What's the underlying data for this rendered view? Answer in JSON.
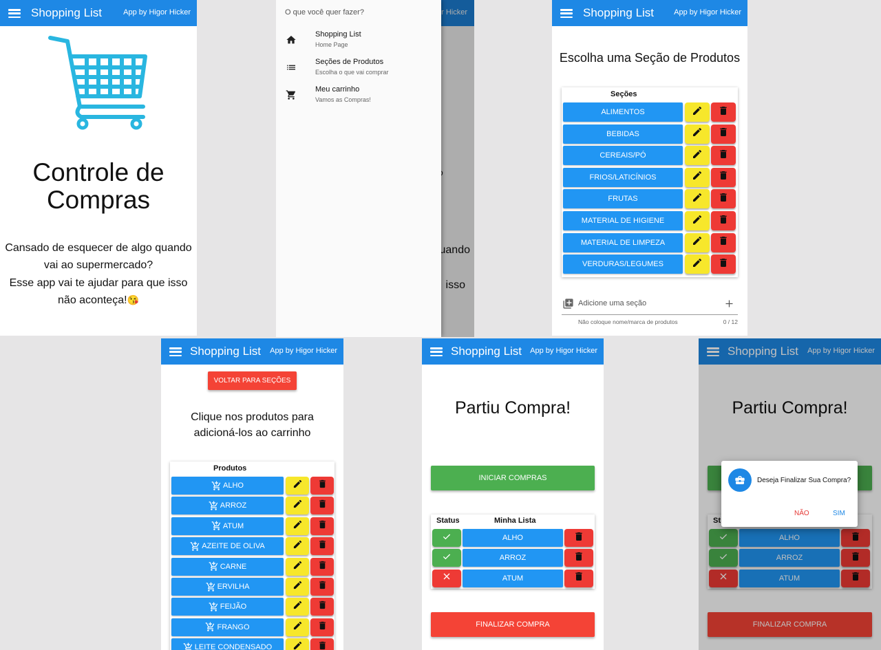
{
  "colors": {
    "appbar": "#1e88e5",
    "blue": "#2196f3",
    "yellow": "#f7e72b",
    "red": "#ee3a35",
    "green": "#4caf50",
    "cart": "#29b6e0"
  },
  "app": {
    "title": "Shopping List",
    "byline": "App by Higor Hicker"
  },
  "home": {
    "title_line1": "Controle de",
    "title_line2": "Compras",
    "desc1": "Cansado de esquecer de algo quando",
    "desc2": "vai ao supermercado?",
    "desc3": "Esse app vai te ajudar para que isso",
    "desc4": "não aconteça!",
    "emoji": "😘"
  },
  "drawer": {
    "header": "O que você quer fazer?",
    "items": [
      {
        "icon": "home-icon",
        "label": "Shopping List",
        "sub": "Home Page"
      },
      {
        "icon": "list-icon",
        "label": "Seções de Produtos",
        "sub": "Escolha o que vai comprar"
      },
      {
        "icon": "cart-icon",
        "label": "Meu carrinho",
        "sub": "Vamos as Compras!"
      }
    ],
    "behind_title": "Higor Hicker",
    "behind_text1": "uando",
    "behind_text2": "isso",
    "behind_text3": "o"
  },
  "sections": {
    "heading": "Escolha uma Seção de Produtos",
    "col_header": "Seções",
    "items": [
      "ALIMENTOS",
      "BEBIDAS",
      "CEREAIS/PÓ",
      "FRIOS/LATICÍNIOS",
      "FRUTAS",
      "MATERIAL DE HIGIENE",
      "MATERIAL DE LIMPEZA",
      "VERDURAS/LEGUMES"
    ],
    "input_placeholder": "Adicione uma seção",
    "input_hint": "Não coloque nome/marca de produtos",
    "input_counter": "0 / 12"
  },
  "products": {
    "back_button": "VOLTAR PARA SEÇÕES",
    "heading_line1": "Clique nos produtos para",
    "heading_line2": "adicioná-los ao carrinho",
    "col_header": "Produtos",
    "items": [
      "ALHO",
      "ARROZ",
      "ATUM",
      "AZEITE DE OLIVA",
      "CARNE",
      "ERVILHA",
      "FEIJÃO",
      "FRANGO",
      "LEITE CONDENSADO"
    ]
  },
  "cart": {
    "heading": "Partiu Compra!",
    "start_button": "INICIAR COMPRAS",
    "col_status": "Status",
    "col_list": "Minha Lista",
    "items": [
      {
        "name": "ALHO",
        "status": "done"
      },
      {
        "name": "ARROZ",
        "status": "done"
      },
      {
        "name": "ATUM",
        "status": "missing"
      }
    ],
    "finish_button": "FINALIZAR COMPRA"
  },
  "dialog": {
    "message": "Deseja Finalizar Sua Compra?",
    "no": "NÃO",
    "yes": "SIM",
    "behind_status": "St"
  }
}
